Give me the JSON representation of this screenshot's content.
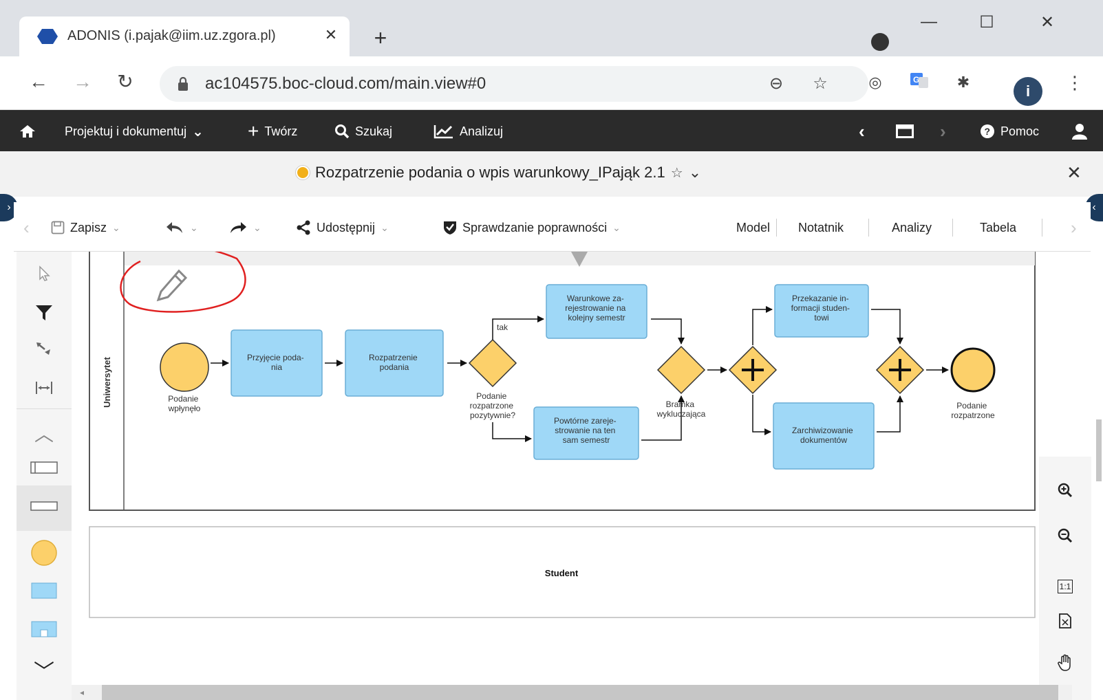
{
  "browser": {
    "tab_title": "ADONIS (i.pajak@iim.uz.zgora.pl)",
    "url": "ac104575.boc-cloud.com/main.view#0",
    "new_tab": "+",
    "tab_close": "✕"
  },
  "appbar": {
    "home_icon": "home-icon",
    "design": "Projektuj i dokumentuj",
    "create": "Twórz",
    "search": "Szukaj",
    "analyze": "Analizuj",
    "help": "Pomoc"
  },
  "document": {
    "title": "Rozpatrzenie podania o wpis warunkowy_IPająk 2.1",
    "star": "☆"
  },
  "model_toolbar": {
    "save": "Zapisz",
    "share": "Udostępnij",
    "validation": "Sprawdzanie poprawności",
    "tabs": [
      "Model",
      "Notatnik",
      "Analizy",
      "Tabela"
    ]
  },
  "diagram": {
    "lane_universitet": "Uniwersytet",
    "lane_student": "Student",
    "start_event": [
      "Podanie",
      "wpłynęło"
    ],
    "task_przyjecie": [
      "Przyjęcie poda-",
      "nia"
    ],
    "task_rozpatrzenie": [
      "Rozpatrzenie",
      "podania"
    ],
    "gateway1": [
      "Podanie",
      "rozpatrzone",
      "pozytywnie?"
    ],
    "flow_tak": "tak",
    "task_warunkowe": [
      "Warunkowe za-",
      "rejestrowanie na",
      "kolejny semestr"
    ],
    "task_powtorne": [
      "Powtórne zareje-",
      "strowanie na ten",
      "sam semestr"
    ],
    "gateway2": [
      "Bramka",
      "wykluczająca"
    ],
    "task_przekazanie": [
      "Przekazanie in-",
      "formacji studen-",
      "towi"
    ],
    "task_zarchiwizowanie": [
      "Zarchiwizowanie",
      "dokumentów"
    ],
    "end_event": [
      "Podanie",
      "rozpatrzone"
    ]
  },
  "zoom": {
    "actual_size": "1:1"
  },
  "colors": {
    "task_fill": "#9fd8f7",
    "task_stroke": "#6aaed6",
    "event_fill": "#fcd06a",
    "gateway_fill": "#fcd06a",
    "appbar_bg": "#2b2b2b",
    "annotation_red": "#e02020"
  }
}
